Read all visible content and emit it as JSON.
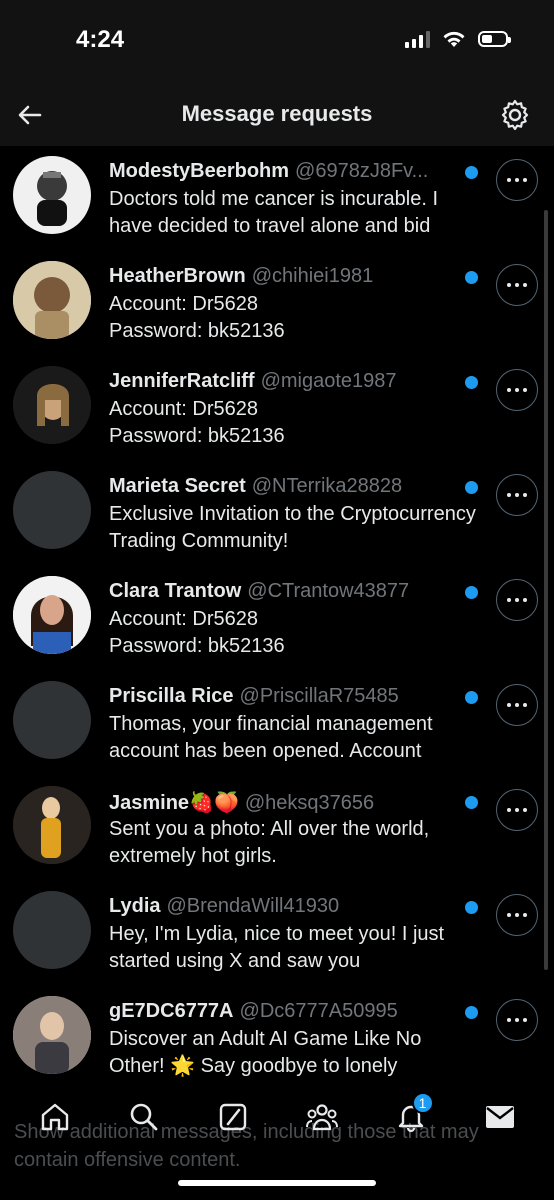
{
  "status": {
    "time": "4:24"
  },
  "header": {
    "title": "Message requests"
  },
  "rows": [
    {
      "name": "ModestyBeerbohm",
      "handle": "@6978zJ8Fv...",
      "message": "Doctors told me cancer is incurable. I have decided to travel alone and bid",
      "avatar": "ape-nft-avatar"
    },
    {
      "name": "HeatherBrown",
      "handle": "@chihiei1981",
      "message": "Account: Dr5628\nPassword: bk52136",
      "avatar": "cartoon-avatar"
    },
    {
      "name": "JenniferRatcliff",
      "handle": "@migaote1987",
      "message": "Account: Dr5628\nPassword: bk52136",
      "avatar": "photo-avatar"
    },
    {
      "name": "Marieta Secret",
      "handle": "@NTerrika28828",
      "message": "Exclusive Invitation to the Cryptocurrency Trading Community!",
      "avatar": "empty-avatar"
    },
    {
      "name": "Clara Trantow",
      "handle": "@CTrantow43877",
      "message": "Account: Dr5628\nPassword: bk52136",
      "avatar": "photo-avatar"
    },
    {
      "name": "Priscilla Rice",
      "handle": "@PriscillaR75485",
      "message": "Thomas, your financial management account has been opened. Account",
      "avatar": "empty-avatar"
    },
    {
      "name": "Jasmine🍓🍑",
      "handle": "@heksq37656",
      "message": "Sent you a photo: All over the world, extremely hot girls.",
      "avatar": "photo-avatar"
    },
    {
      "name": "Lydia",
      "handle": "@BrendaWill41930",
      "message": "Hey, I'm Lydia, nice to meet you! I just started using X and saw you",
      "avatar": "empty-avatar"
    },
    {
      "name": "gE7DC6777A",
      "handle": "@Dc6777A50995",
      "message": "Discover an Adult AI Game Like No Other! 🌟 Say goodbye to lonely",
      "avatar": "photo-avatar"
    }
  ],
  "footer": {
    "note": "Show additional messages, including those that may contain offensive content."
  },
  "tabs": {
    "notifications_badge": "1"
  },
  "colors": {
    "accent": "#1d9bf0",
    "background": "#000000",
    "secondary_text": "#71767b"
  }
}
